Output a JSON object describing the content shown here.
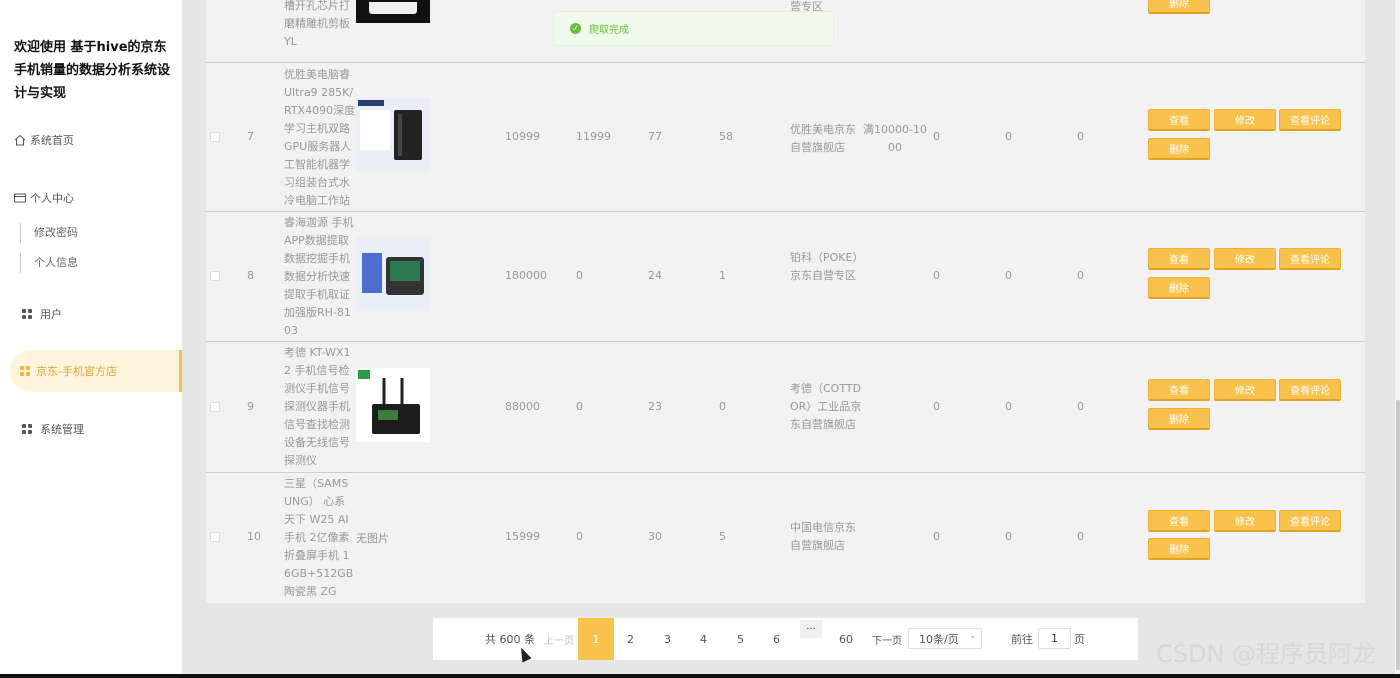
{
  "app": {
    "title": "欢迎使用 基于hive的京东手机销量的数据分析系统设计与实现"
  },
  "sidebar": {
    "items": [
      {
        "label": "系统首页",
        "icon": "home-icon"
      },
      {
        "label": "个人中心",
        "icon": "card-icon"
      },
      {
        "label": "修改密码"
      },
      {
        "label": "个人信息"
      },
      {
        "label": "用户",
        "icon": "grid-icon"
      },
      {
        "label": "京东-手机官方店",
        "icon": "grid-icon",
        "active": true
      },
      {
        "label": "系统管理",
        "icon": "grid-icon"
      }
    ]
  },
  "toast": {
    "message": "爬取完成"
  },
  "table": {
    "actions": {
      "view": "查看",
      "edit": "修改",
      "comments": "查看评论",
      "delete": "删除"
    },
    "top_row": {
      "name_tail": "槽开孔芯片打磨精雕机剪板YL",
      "shop_tail": "营专区"
    },
    "rows": [
      {
        "index": "7",
        "name": "优胜美电脑睿Ultra9 285K/RTX4090深度学习主机双路GPU服务器人工智能机器学习组装台式水冷电脑工作站",
        "image": "pc-tower",
        "price": "10999",
        "orig_price": "11999",
        "c1": "77",
        "c2": "58",
        "shop": "优胜美电京东自营旗舰店",
        "promo": "满10000-1000",
        "d1": "0",
        "d2": "0",
        "d3": "0"
      },
      {
        "index": "8",
        "name": "睿海迦源 手机APP数据提取数据挖掘手机数据分析快速提取手机取证加强版RH-8103",
        "image": "case-device",
        "price": "180000",
        "orig_price": "0",
        "c1": "24",
        "c2": "1",
        "shop": "铂科（POKE）京东自营专区",
        "promo": "",
        "d1": "0",
        "d2": "0",
        "d3": "0"
      },
      {
        "index": "9",
        "name": "考德 KT-WX12 手机信号检测仪手机信号探测仪器手机信号查找检测设备无线信号探测仪",
        "image": "detector",
        "price": "88000",
        "orig_price": "0",
        "c1": "23",
        "c2": "0",
        "shop": "考德（COTTDOR）工业品京东自营旗舰店",
        "promo": "",
        "d1": "0",
        "d2": "0",
        "d3": "0"
      },
      {
        "index": "10",
        "name": "三星（SAMSUNG） 心系天下 W25 AI手机 2亿像素 折叠屏手机 16GB+512GB 陶瓷黑 ZG",
        "image": "",
        "no_image": "无图片",
        "price": "15999",
        "orig_price": "0",
        "c1": "30",
        "c2": "5",
        "shop": "中国电信京东自营旗舰店",
        "promo": "",
        "d1": "0",
        "d2": "0",
        "d3": "0"
      }
    ]
  },
  "pagination": {
    "total": "共 600 条",
    "prev": "上一页",
    "pages": [
      "1",
      "2",
      "3",
      "4",
      "5",
      "6"
    ],
    "ellipsis": "···",
    "last": "60",
    "next": "下一页",
    "page_size": "10条/页",
    "goto_label": "前往",
    "goto_value": "1",
    "goto_suffix": "页"
  },
  "watermark": "CSDN @程序员阿龙"
}
